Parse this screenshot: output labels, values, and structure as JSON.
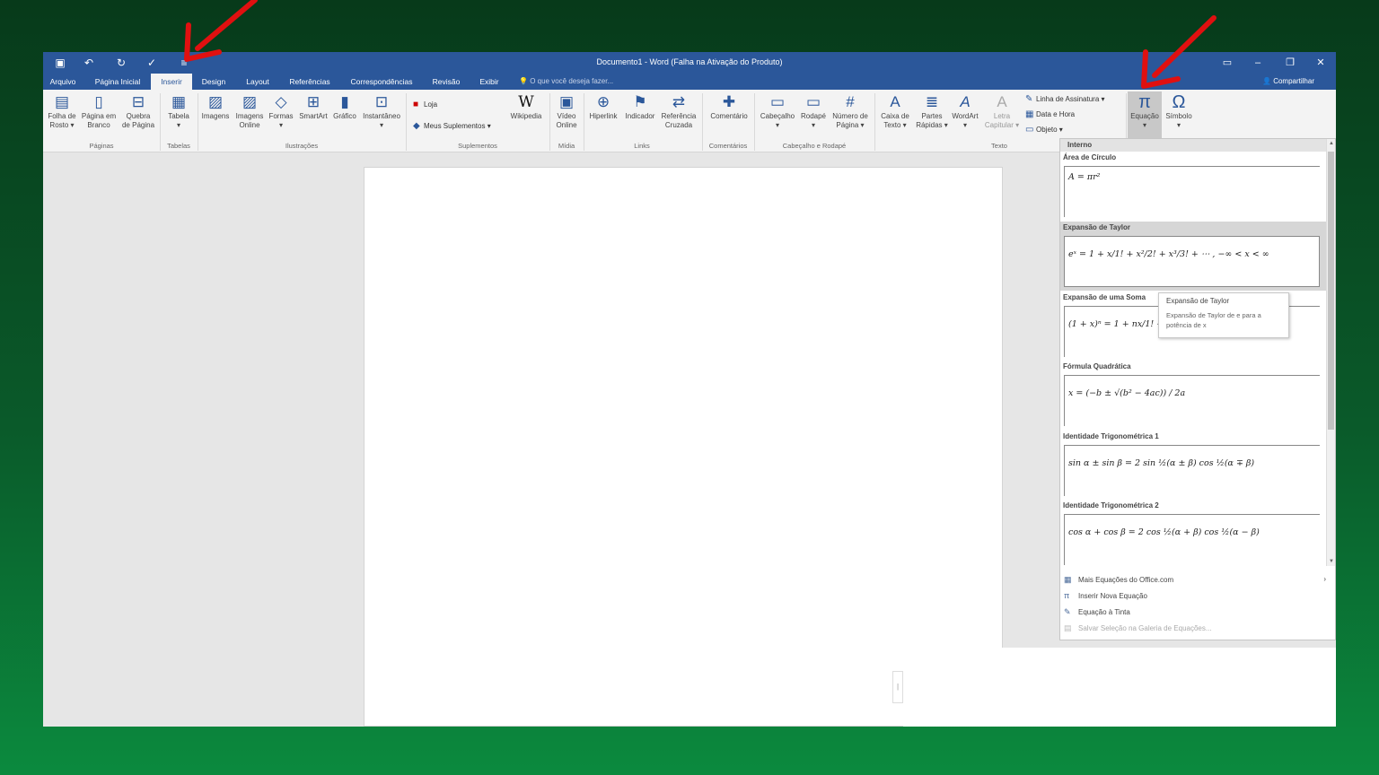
{
  "window": {
    "title": "Documento1 - Word (Falha na Ativação do Produto)"
  },
  "tabs": [
    "Arquivo",
    "Página Inicial",
    "Inserir",
    "Design",
    "Layout",
    "Referências",
    "Correspondências",
    "Revisão",
    "Exibir"
  ],
  "tell_me": "O que você deseja fazer...",
  "share": "Compartilhar",
  "ribbon": {
    "folha": "Folha de\nRosto ▾",
    "pagina_branco": "Página em\nBranco",
    "quebra": "Quebra\nde Página",
    "tabela": "Tabela\n▾",
    "imagens": "Imagens",
    "imagens_online": "Imagens\nOnline",
    "formas": "Formas\n▾",
    "smartart": "SmartArt",
    "grafico": "Gráfico",
    "instantaneo": "Instantâneo\n▾",
    "loja": "Loja",
    "meus_suplementos": "Meus Suplementos",
    "wikipedia": "Wikipedia",
    "video": "Vídeo\nOnline",
    "hiperlink": "Hiperlink",
    "indicador": "Indicador",
    "referencia": "Referência\nCruzada",
    "comentario": "Comentário",
    "cabecalho": "Cabeçalho\n▾",
    "rodape": "Rodapé\n▾",
    "numero": "Número de\nPágina ▾",
    "caixa": "Caixa de\nTexto ▾",
    "partes": "Partes\nRápidas ▾",
    "wordart": "WordArt\n▾",
    "letra": "Letra\nCapitular ▾",
    "linha_assinatura": "Linha de Assinatura ▾",
    "data_hora": "Data e Hora",
    "objeto": "Objeto ▾",
    "equacao": "Equação\n▾",
    "simbolo": "Símbolo\n▾",
    "groups": {
      "paginas": "Páginas",
      "tabelas": "Tabelas",
      "ilustracoes": "Ilustrações",
      "suplementos": "Suplementos",
      "midia": "Mídia",
      "links": "Links",
      "comentarios": "Comentários",
      "cab_rod": "Cabeçalho e Rodapé",
      "texto": "Texto"
    }
  },
  "gallery": {
    "header": "Interno",
    "items": [
      {
        "title": "Área de Círculo",
        "eq": "A = πr²"
      },
      {
        "title": "Expansão de Taylor",
        "eq": "eˣ = 1 + x/1! + x²/2! + x³/3! + ⋯ ,     −∞ < x < ∞"
      },
      {
        "title": "Expansão de uma Soma",
        "eq": "(1 + x)ⁿ = 1 + nx/1! + ⋯"
      },
      {
        "title": "Fórmula Quadrática",
        "eq": "x = (−b ± √(b² − 4ac)) / 2a"
      },
      {
        "title": "Identidade Trigonométrica 1",
        "eq": "sin α ± sin β = 2 sin ½(α ± β) cos ½(α ∓ β)"
      },
      {
        "title": "Identidade Trigonométrica 2",
        "eq": "cos α + cos β = 2 cos ½(α + β) cos ½(α − β)"
      }
    ],
    "tooltip_title": "Expansão de Taylor",
    "tooltip_desc": "Expansão de Taylor de e para a potência de x",
    "commands": [
      "Mais Equações do Office.com",
      "Inserir Nova Equação",
      "Equação à Tinta",
      "Salvar Seleção na Galeria de Equações..."
    ]
  },
  "colors": {
    "accent": "#2b579a",
    "arrow": "#e01010"
  }
}
